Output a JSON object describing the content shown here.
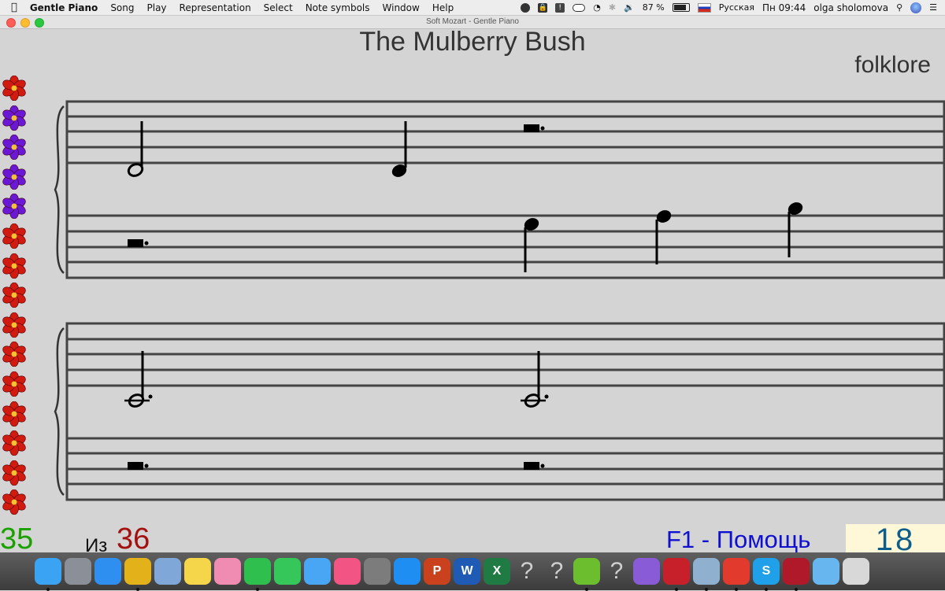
{
  "menubar": {
    "app_name": "Gentle Piano",
    "items": [
      "Song",
      "Play",
      "Representation",
      "Select",
      "Note symbols",
      "Window",
      "Help"
    ],
    "battery": "87 %",
    "input_source": "Русская",
    "clock": "Пн 09:44",
    "user": "olga sholomova"
  },
  "window": {
    "title": "Soft Mozart - Gentle Piano"
  },
  "song": {
    "title": "The Mulberry Bush",
    "author": "folklore"
  },
  "flowers": {
    "colors": [
      "red",
      "purple",
      "purple",
      "purple",
      "purple",
      "red",
      "red",
      "red",
      "red",
      "red",
      "red",
      "red",
      "red",
      "red",
      "red"
    ],
    "red": "#d11a10",
    "purple": "#6a18d6"
  },
  "progress": {
    "current": "35",
    "of_label": "Из",
    "total": "36"
  },
  "help": {
    "text": "F1 - Помощь"
  },
  "score_box": {
    "value": "18"
  },
  "dock": {
    "items": [
      {
        "name": "finder-icon",
        "label": "",
        "color": "#3aa3f3",
        "dot": true
      },
      {
        "name": "launchpad-icon",
        "label": "",
        "color": "#8b8f98",
        "dot": false
      },
      {
        "name": "safari-icon",
        "label": "",
        "color": "#2f8ff0",
        "dot": false
      },
      {
        "name": "chrome-icon",
        "label": "",
        "color": "#e3b21b",
        "dot": true
      },
      {
        "name": "mail-icon",
        "label": "",
        "color": "#7fa7d8",
        "dot": false
      },
      {
        "name": "notes-icon",
        "label": "",
        "color": "#f5d54a",
        "dot": false
      },
      {
        "name": "photos-icon",
        "label": "",
        "color": "#f08bb1",
        "dot": false
      },
      {
        "name": "whatsapp-icon",
        "label": "",
        "color": "#2fbf4e",
        "dot": true
      },
      {
        "name": "facetime-icon",
        "label": "",
        "color": "#35c75a",
        "dot": false
      },
      {
        "name": "messages-icon",
        "label": "",
        "color": "#49a6f5",
        "dot": false
      },
      {
        "name": "itunes-icon",
        "label": "",
        "color": "#f25583",
        "dot": false
      },
      {
        "name": "system-preferences-icon",
        "label": "",
        "color": "#7c7c7c",
        "dot": false
      },
      {
        "name": "app-store-icon",
        "label": "",
        "color": "#1e8ef2",
        "dot": false
      },
      {
        "name": "powerpoint-icon",
        "label": "P",
        "color": "#c9421d",
        "dot": false
      },
      {
        "name": "word-icon",
        "label": "W",
        "color": "#1f5bb4",
        "dot": false
      },
      {
        "name": "excel-icon",
        "label": "X",
        "color": "#1f7a43",
        "dot": false
      },
      {
        "name": "unknown-app-icon",
        "label": "?",
        "color": "transparent",
        "dot": false
      },
      {
        "name": "unknown-app-icon",
        "label": "?",
        "color": "transparent",
        "dot": false
      },
      {
        "name": "utorrent-icon",
        "label": "",
        "color": "#6cbe2f",
        "dot": true
      },
      {
        "name": "unknown-app-icon",
        "label": "?",
        "color": "transparent",
        "dot": false
      },
      {
        "name": "visual-studio-icon",
        "label": "",
        "color": "#8a5bd6",
        "dot": false
      },
      {
        "name": "parallels-icon",
        "label": "",
        "color": "#c8202a",
        "dot": true
      },
      {
        "name": "preview-icon",
        "label": "",
        "color": "#8fb0cf",
        "dot": true
      },
      {
        "name": "anydesk-icon",
        "label": "",
        "color": "#e23b2d",
        "dot": true
      },
      {
        "name": "skype-icon",
        "label": "S",
        "color": "#1fa0e8",
        "dot": true
      },
      {
        "name": "gentle-piano-icon",
        "label": "",
        "color": "#b0192a",
        "dot": true
      },
      {
        "name": "downloads-folder-icon",
        "label": "",
        "color": "#67b6f0",
        "dot": false
      },
      {
        "name": "trash-icon",
        "label": "",
        "color": "#d8d8d8",
        "dot": false
      }
    ]
  }
}
